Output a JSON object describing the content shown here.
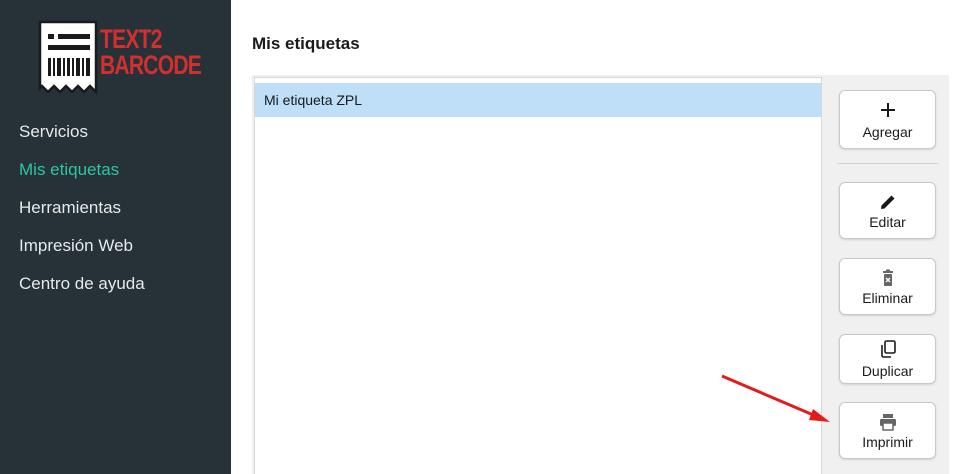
{
  "logo": {
    "line1": "TEXT2",
    "line2": "BARCODE",
    "color": "#d32f2f"
  },
  "sidebar": {
    "background": "#263238",
    "active_color": "#2ec4a5",
    "items": [
      {
        "label": "Servicios",
        "active": false
      },
      {
        "label": "Mis etiquetas",
        "active": true
      },
      {
        "label": "Herramientas",
        "active": false
      },
      {
        "label": "Impresión Web",
        "active": false
      },
      {
        "label": "Centro de ayuda",
        "active": false
      }
    ]
  },
  "main": {
    "title": "Mis etiquetas",
    "labels": [
      {
        "name": "Mi etiqueta ZPL",
        "selected": true
      }
    ]
  },
  "actions": {
    "add": {
      "label": "Agregar",
      "icon": "plus-icon"
    },
    "edit": {
      "label": "Editar",
      "icon": "pencil-icon"
    },
    "delete": {
      "label": "Eliminar",
      "icon": "trash-icon"
    },
    "duplicate": {
      "label": "Duplicar",
      "icon": "copy-icon"
    },
    "print": {
      "label": "Imprimir",
      "icon": "printer-icon"
    }
  },
  "annotation": {
    "arrow_color": "#e31b1b",
    "points_to": "print"
  }
}
